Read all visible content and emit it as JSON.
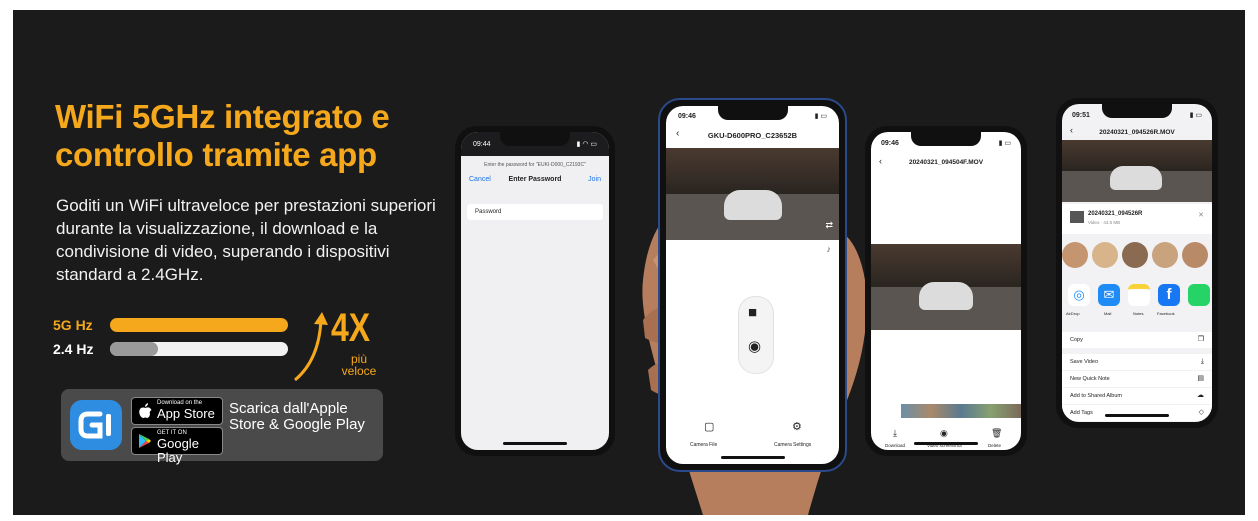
{
  "headline": {
    "line1": "WiFi 5GHz integrato e",
    "line2": "controllo tramite app"
  },
  "description": "Goditi un WiFi ultraveloce per prestazioni superiori durante la visualizzazione, il download e la condivisione di video, superando i dispositivi standard a 2.4GHz.",
  "speed": {
    "label_5g": "5G Hz",
    "label_24": "2.4 Hz",
    "multiplier": "4X",
    "caption_line1": "più",
    "caption_line2": "veloce",
    "fill_5g": 1.0,
    "fill_24": 0.27
  },
  "store": {
    "app_store_small": "Download on the",
    "app_store_big": "App Store",
    "google_small": "GET IT ON",
    "google_big": "Google Play",
    "text": "Scarica dall'Apple Store & Google Play"
  },
  "phone1": {
    "time": "09:44",
    "prompt": "Enter the password for \"EUKI-D000_C2193C\"",
    "cancel": "Cancel",
    "title": "Enter Password",
    "join": "Join",
    "field_label": "Password"
  },
  "phone2": {
    "time": "09:46",
    "title": "GKU-D600PRO_C23652B",
    "camera_file": "Camera File",
    "camera_settings": "Camera Settings"
  },
  "phone3": {
    "time": "09:46",
    "title": "20240321_094504F.MOV",
    "download": "Download",
    "video_screenshot": "Video screenshot",
    "delete": "Delete"
  },
  "phone4": {
    "time": "09:51",
    "title": "20240321_094526R.MOV",
    "file_name": "20240321_094526R",
    "file_meta": "Video · 43.5 MB",
    "apps": [
      "AirDrop",
      "Mail",
      "Notes",
      "Facebook"
    ],
    "actions": [
      "Copy",
      "Save Video",
      "New Quick Note",
      "Add to Shared Album",
      "Add Tags"
    ]
  },
  "colors": {
    "accent": "#f5a81c",
    "background": "#1b1b1b",
    "brand_blue": "#2e8de0"
  }
}
